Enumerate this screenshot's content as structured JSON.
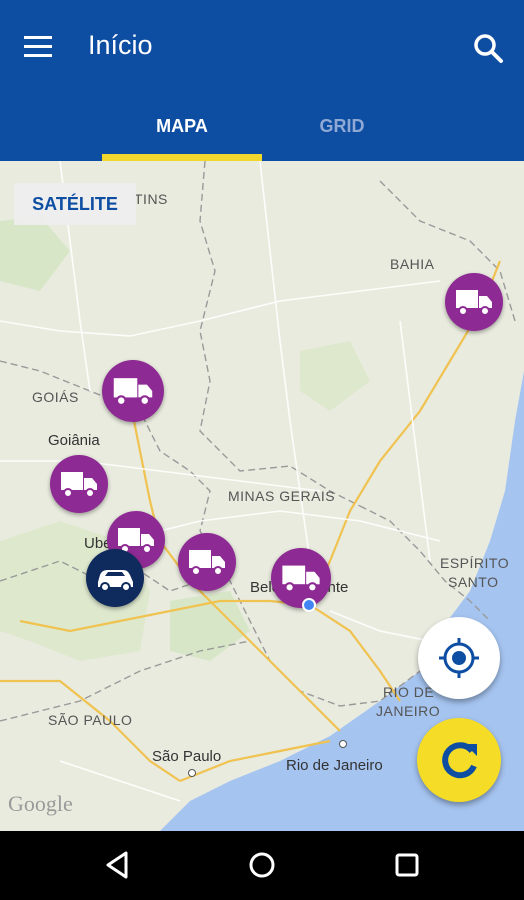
{
  "header": {
    "title": "Início"
  },
  "tabs": [
    {
      "label": "MAPA",
      "active": true
    },
    {
      "label": "GRID",
      "active": false
    }
  ],
  "map": {
    "satellite_label": "SATÉLITE",
    "labels": {
      "tins": "TINS",
      "bahia": "BAHIA",
      "goias": "GOIÁS",
      "goiania": "Goiânia",
      "minas_gerais": "MINAS GERAIS",
      "ube": "Ube",
      "belo_horizonte": "Belo Horizonte",
      "espirito_santo_1": "ESPÍRITO",
      "espirito_santo_2": "SANTO",
      "rio_state_1": "RIO DE",
      "rio_state_2": "JANEIRO",
      "sao_paulo_state": "SÃO PAULO",
      "sao_paulo_city": "São Paulo",
      "rio_city": "Rio de Janeiro"
    },
    "attribution": "Google"
  },
  "colors": {
    "primary": "#0d4ea3",
    "accent": "#f2d72c",
    "truck_marker": "#8e2a93",
    "car_marker": "#0f2a5c",
    "water": "#a5c4f0"
  }
}
